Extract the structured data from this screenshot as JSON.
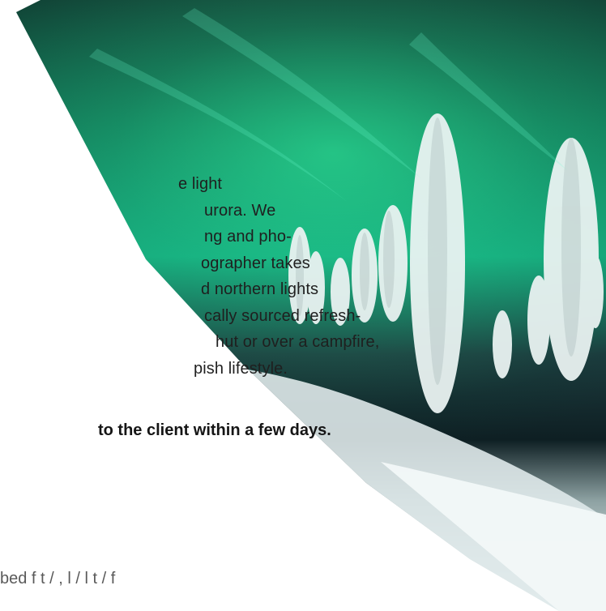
{
  "content": {
    "para_lines": [
      "e light",
      "urora. We",
      "ng and pho-",
      "ographer takes",
      "d  northern  lights",
      "cally sourced refresh-",
      "hut or over a campfire,",
      "pish lifestyle."
    ],
    "bold_line": "to the client within a few days.",
    "partial_bottom_line": "  bed   f  t     /        ,   l   /     l  t   /   f"
  },
  "image": {
    "subject": "Aurora borealis over snow-covered trees",
    "colors": {
      "aurora_green": "#35ffa8",
      "deep_green": "#0f6f52",
      "snow": "#ecf4f4",
      "night": "#0e1f23"
    }
  }
}
